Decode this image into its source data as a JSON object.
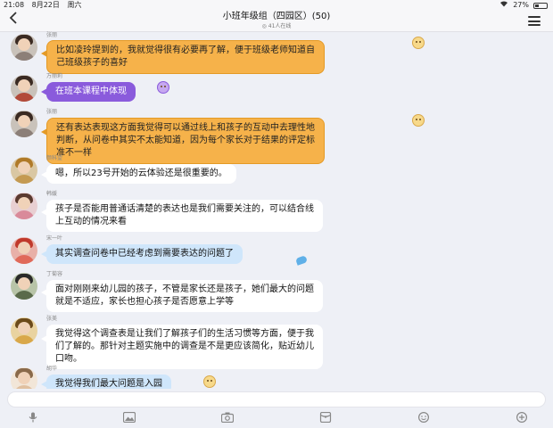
{
  "status_bar": {
    "time": "21:08",
    "date": "8月22日",
    "weekday": "周六",
    "battery": "27%",
    "battery_level": 0.27
  },
  "header": {
    "title": "小班年级组（四园区）(50)",
    "online": "41人在线"
  },
  "messages": [
    {
      "sender": "张丽",
      "style": "orange",
      "lines": [
        "比如凌玲提到的，我就觉得很有必要再了解，便于班级老师知道自",
        "己班级孩子的喜好"
      ]
    },
    {
      "sender": "万丽莉",
      "style": "purple",
      "lines": [
        "在班本课程中体现"
      ]
    },
    {
      "sender": "张丽",
      "style": "orange",
      "lines": [
        "还有表达表现这方面我觉得可以通过线上和孩子的互动中去理性地",
        "判断，从问卷中其实不太能知道，因为每个家长对于结果的评定标",
        "准不一样"
      ]
    },
    {
      "sender": "颜科望",
      "style": "white",
      "lines": [
        "嗯，所以23号开始的云体验还是很重要的。"
      ]
    },
    {
      "sender": "韩媛",
      "style": "white",
      "lines": [
        "孩子是否能用普通话清楚的表达也是我们需要关注的，可以结合线",
        "上互动的情况来看"
      ]
    },
    {
      "sender": "宋一叶",
      "style": "blue",
      "lines": [
        "其实调查问卷中已经考虑到需要表达的问题了"
      ]
    },
    {
      "sender": "丁菊容",
      "style": "white",
      "lines": [
        "面对刚刚来幼儿园的孩子，不管是家长还是孩子，她们最大的问题",
        "就是不适应，家长也担心孩子是否愿意上学等"
      ]
    },
    {
      "sender": "张美",
      "style": "white",
      "lines": [
        "我觉得这个调查表是让我们了解孩子们的生活习惯等方面，便于我",
        "们了解的。那针对主题实施中的调查是不是更应该简化，贴近幼儿",
        "口吻。"
      ]
    },
    {
      "sender": "胡华",
      "style": "blue",
      "lines": [
        "我觉得我们最大问题是入园"
      ]
    }
  ],
  "icons": {
    "back": "back-arrow-icon",
    "menu": "menu-icon",
    "toolbar": [
      "microphone-icon",
      "picture-icon",
      "camera-icon",
      "red-envelope-icon",
      "emoji-icon",
      "plus-icon"
    ]
  }
}
